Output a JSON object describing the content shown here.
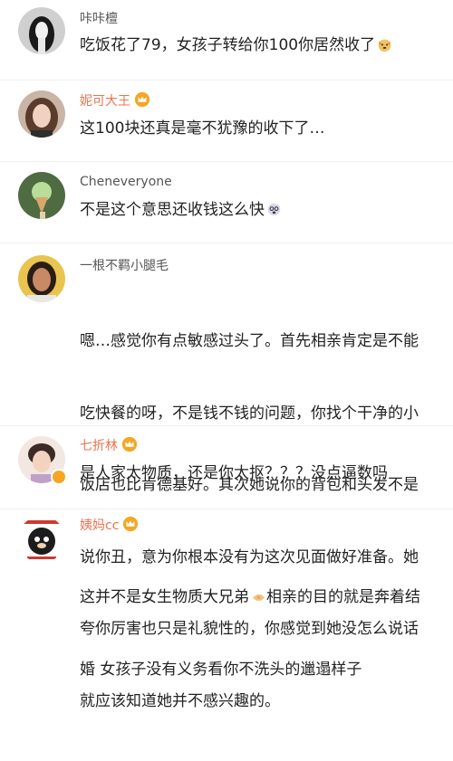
{
  "comments": [
    {
      "name": "咔咔檀",
      "text": "吃饭花了79，女孩子转给你100你居然收了",
      "emoji": "dog-emoji"
    },
    {
      "name": "妮可大王",
      "text": "这100块还真是毫不犹豫的收下了…",
      "badge": "crown-icon"
    },
    {
      "name": "Cheneveryone",
      "text": "不是这个意思还收钱这么快",
      "emoji": "dizzy-face-emoji"
    },
    {
      "name": "一根不羁小腿毛",
      "lines": [
        "嗯…感觉你有点敏感过头了。首先相亲肯定是不能",
        "吃快餐的呀，不是钱不钱的问题，你找个干净的小",
        "饭店也比肯德基好。其次她说你的背包和头发不是",
        "说你丑，意为你根本没有为这次见面做好准备。她",
        "夸你厉害也只是礼貌性的，你感觉到她没怎么说话",
        "就应该知道她并不感兴趣的。"
      ]
    },
    {
      "name": "七折林",
      "text": "是人家太物质，还是你太抠？？？没点逼数吗",
      "badge": "crown-icon"
    },
    {
      "name": "姨妈cc",
      "lines": [
        "这并不是女生物质大兄弟",
        "相亲的目的就是奔着结",
        "婚 女孩子没有义务看你不洗头的邋遢样子"
      ],
      "badge": "crown-icon",
      "emoji": "handshake-emoji"
    }
  ],
  "colors": {
    "vip_name": "#eb7350",
    "normal_name": "#555555",
    "crown": "#f5a623"
  }
}
